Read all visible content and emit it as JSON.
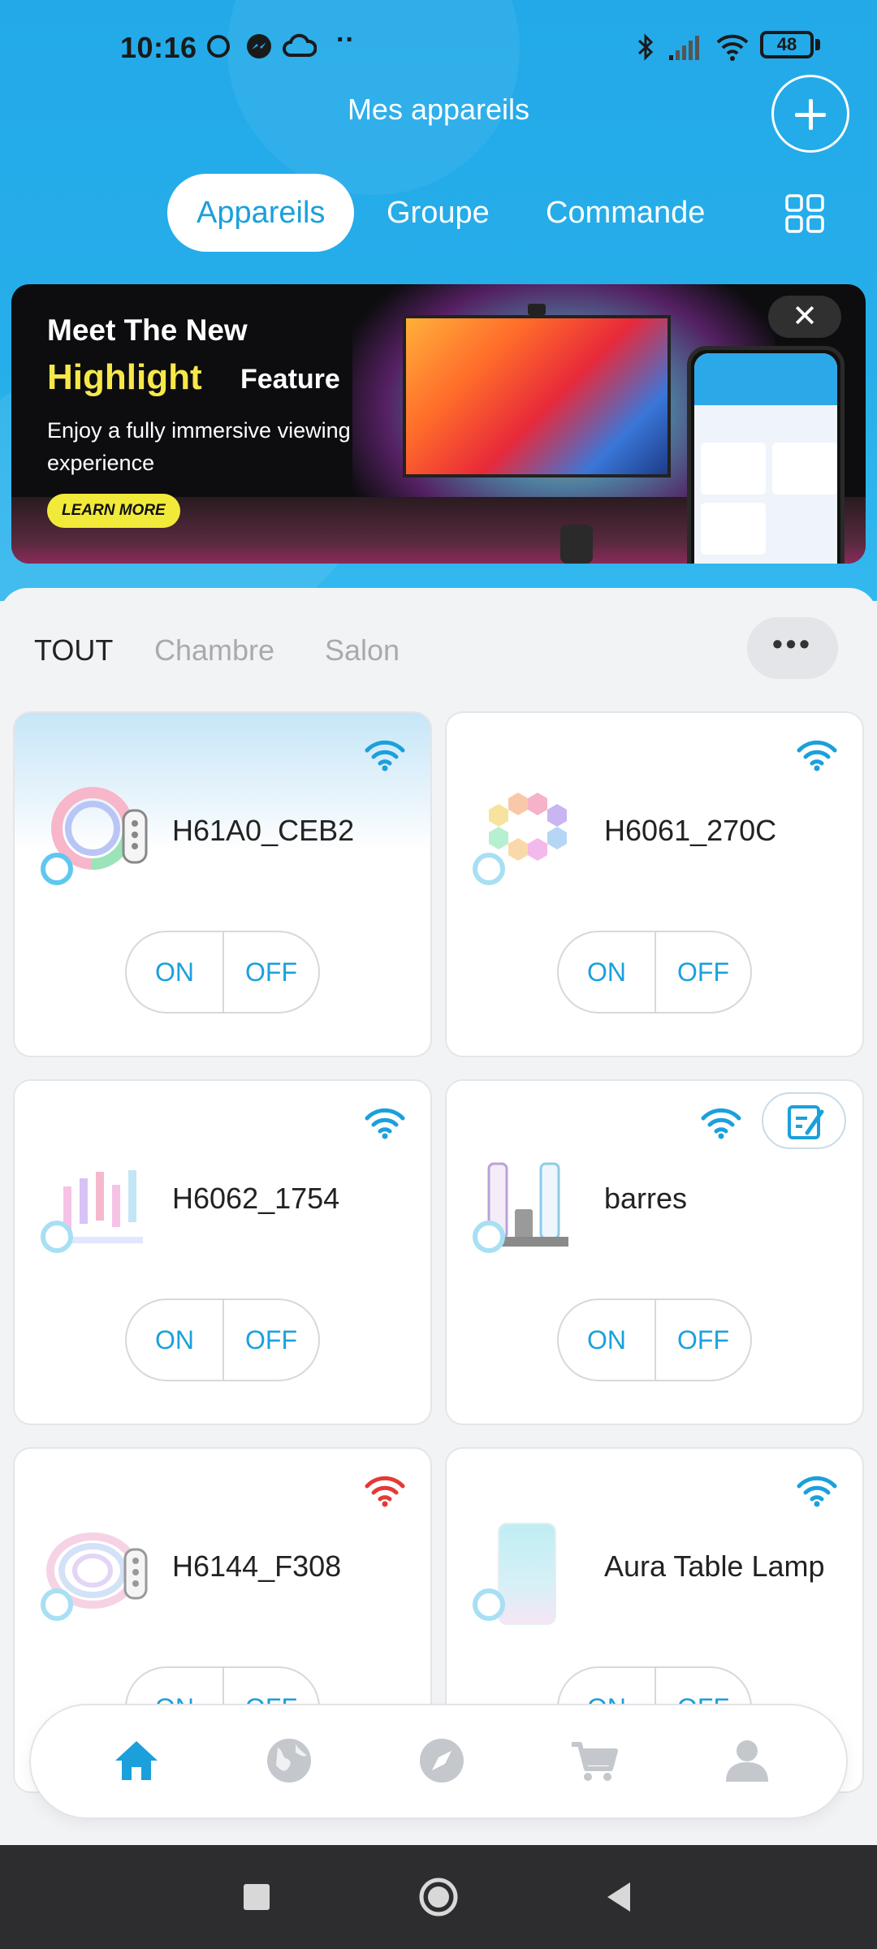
{
  "status_bar": {
    "time": "10:16",
    "battery": "48"
  },
  "header": {
    "title": "Mes appareils",
    "tabs": [
      {
        "label": "Appareils",
        "active": true
      },
      {
        "label": "Groupe",
        "active": false
      },
      {
        "label": "Commande",
        "active": false
      }
    ]
  },
  "banner": {
    "line1": "Meet The New",
    "line2_highlight": "Highlight",
    "line2_rest": "Feature",
    "subtitle": "Enjoy a fully immersive viewing experience",
    "cta": "LEARN MORE"
  },
  "filters": [
    {
      "label": "TOUT",
      "active": true
    },
    {
      "label": "Chambre",
      "active": false
    },
    {
      "label": "Salon",
      "active": false
    }
  ],
  "more_label": "•••",
  "devices": [
    {
      "name": "H61A0_CEB2",
      "on": "ON",
      "off": "OFF",
      "wifi_color": "#1ba0dc"
    },
    {
      "name": "H6061_270C",
      "on": "ON",
      "off": "OFF",
      "wifi_color": "#1ba0dc"
    },
    {
      "name": "H6062_1754",
      "on": "ON",
      "off": "OFF",
      "wifi_color": "#1ba0dc"
    },
    {
      "name": "barres",
      "on": "ON",
      "off": "OFF",
      "wifi_color": "#1ba0dc"
    },
    {
      "name": "H6144_F308",
      "on": "ON",
      "off": "OFF",
      "wifi_color": "#e53935"
    },
    {
      "name": "Aura Table Lamp",
      "on": "ON",
      "off": "OFF",
      "wifi_color": "#1ba0dc"
    }
  ],
  "bottom_nav": [
    {
      "icon": "home-icon",
      "active": true
    },
    {
      "icon": "globe-icon",
      "active": false
    },
    {
      "icon": "compass-icon",
      "active": false
    },
    {
      "icon": "cart-icon",
      "active": false
    },
    {
      "icon": "profile-icon",
      "active": false
    }
  ],
  "colors": {
    "accent": "#1ba0dc",
    "header": "#26aeea",
    "wifi_off": "#e53935"
  }
}
